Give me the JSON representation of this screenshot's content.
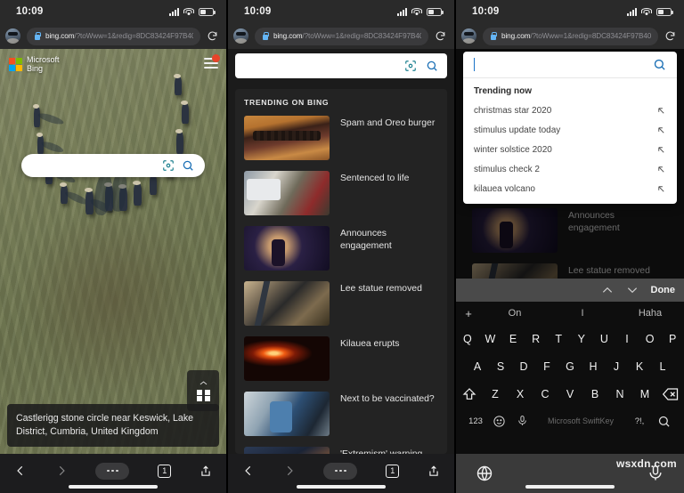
{
  "status_bar": {
    "time": "10:09",
    "icons": [
      "signal-icon",
      "wifi-icon",
      "battery-icon"
    ]
  },
  "url_bar": {
    "domain": "bing.com",
    "path": "/?toWww=1&redig=8DC83424F97B40...",
    "reload_label": "reload-icon",
    "lock_label": "lock-icon"
  },
  "panel1": {
    "brand_line1": "Microsoft",
    "brand_line2": "Bing",
    "menu_badge": "",
    "search_placeholder": "",
    "caption": "Castlerigg stone circle near Keswick, Lake District, Cumbria, United Kingdom",
    "gift_label": "gift-icon"
  },
  "panel2": {
    "search_placeholder": "",
    "feed_header": "TRENDING ON BING",
    "items": [
      {
        "title": "Spam and Oreo burger",
        "thumb": "th-burger"
      },
      {
        "title": "Sentenced to life",
        "thumb": "th-car"
      },
      {
        "title": "Announces engagement",
        "thumb": "th-singer"
      },
      {
        "title": "Lee statue removed",
        "thumb": "th-statue"
      },
      {
        "title": "Kilauea erupts",
        "thumb": "th-lava"
      },
      {
        "title": "Next to be vaccinated?",
        "thumb": "th-vac"
      },
      {
        "title": "'Extremism' warning",
        "thumb": "th-cnn"
      }
    ]
  },
  "panel3": {
    "search_value": "",
    "suggest_header": "Trending now",
    "suggestions": [
      "christmas star 2020",
      "stimulus update today",
      "winter solstice 2020",
      "stimulus check 2",
      "kilauea volcano"
    ],
    "background_items": [
      {
        "title": "Announces engagement",
        "thumb": "th-singer"
      },
      {
        "title": "Lee statue removed",
        "thumb": "th-statue"
      }
    ],
    "keyboard_toolbar": {
      "done_label": "Done"
    },
    "keyboard": {
      "predictions": [
        "On",
        "I",
        "Haha"
      ],
      "plus": "+",
      "row1": [
        "Q",
        "W",
        "E",
        "R",
        "T",
        "Y",
        "U",
        "I",
        "O",
        "P"
      ],
      "row2": [
        "A",
        "S",
        "D",
        "F",
        "G",
        "H",
        "J",
        "K",
        "L"
      ],
      "row3": [
        "Z",
        "X",
        "C",
        "V",
        "B",
        "N",
        "M"
      ],
      "numeric_label": "123",
      "space_label": "Microsoft SwiftKey",
      "punct_label": "?!,",
      "shift_label": "shift-icon",
      "backspace_label": "backspace-icon",
      "emoji_label": "emoji-icon",
      "mic_label": "microphone-icon",
      "search_label": "search-icon"
    }
  },
  "bottom_bar": {
    "back": "back-icon",
    "forward": "forward-icon",
    "more": "more-icon",
    "tabs_count": "1",
    "share": "share-icon"
  },
  "watermark": "wsxdn.com",
  "colors": {
    "dark_chrome": "#2a2a2a",
    "panel_bg": "#1b1b1b",
    "card_bg": "#232323",
    "accent_blue": "#1a6fb5",
    "lens_teal": "#1a7f8e",
    "badge_red": "#e8442a"
  }
}
